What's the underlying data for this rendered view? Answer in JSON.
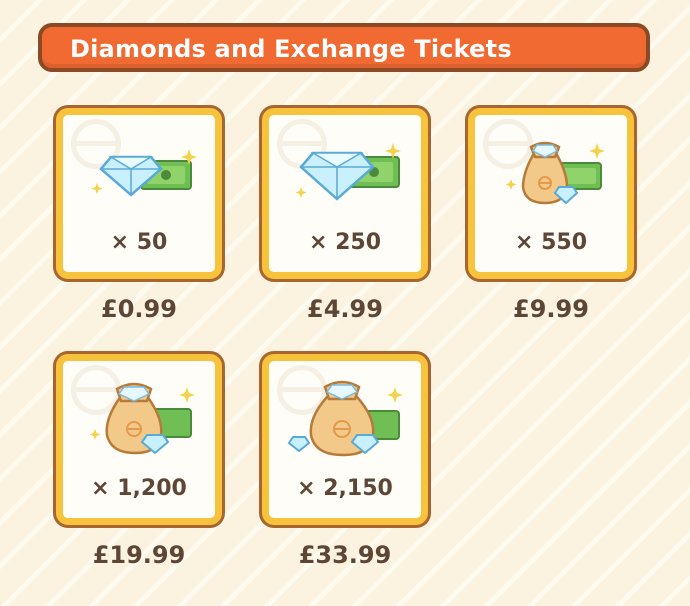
{
  "header": {
    "title": "Diamonds and Exchange Tickets"
  },
  "items": [
    {
      "quantity": "× 50",
      "price": "£0.99",
      "icon": "diamond-with-ticket-icon"
    },
    {
      "quantity": "× 250",
      "price": "£4.99",
      "icon": "large-diamond-with-ticket-icon"
    },
    {
      "quantity": "× 550",
      "price": "£9.99",
      "icon": "diamond-bag-with-ticket-icon"
    },
    {
      "quantity": "× 1,200",
      "price": "£19.99",
      "icon": "large-diamond-bag-with-ticket-icon"
    },
    {
      "quantity": "× 2,150",
      "price": "£33.99",
      "icon": "extra-large-diamond-bag-with-ticket-icon"
    }
  ],
  "colors": {
    "header_bg": "#f06a32",
    "header_border": "#8a4a26",
    "card_border": "#f7c33c",
    "text": "#5e4637",
    "background": "#fbf3df"
  }
}
